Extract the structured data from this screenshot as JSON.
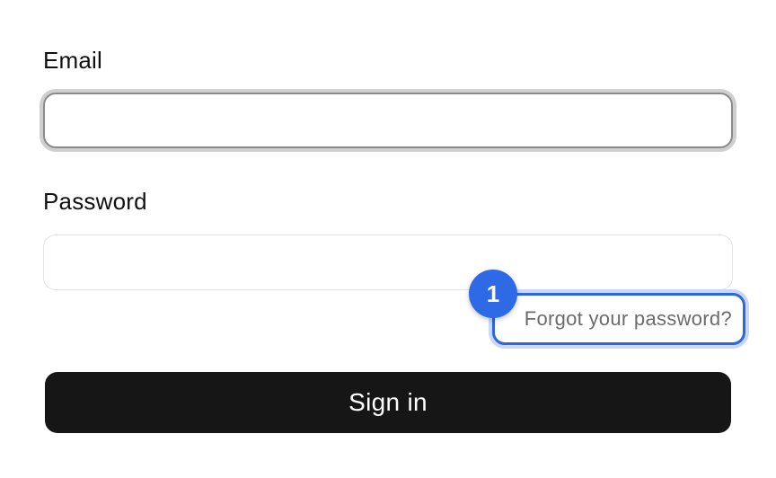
{
  "form": {
    "email_label": "Email",
    "email_value": "",
    "email_placeholder": "",
    "password_label": "Password",
    "password_value": "",
    "password_placeholder": "",
    "forgot_link": "Forgot your password?",
    "signin_button": "Sign in"
  },
  "annotation": {
    "badge_number": "1"
  },
  "colors": {
    "button_bg": "#161616",
    "button_text": "#ffffff",
    "highlight": "#2f66e0",
    "badge": "#2f6ae6",
    "link_text": "#6b6b6b"
  }
}
